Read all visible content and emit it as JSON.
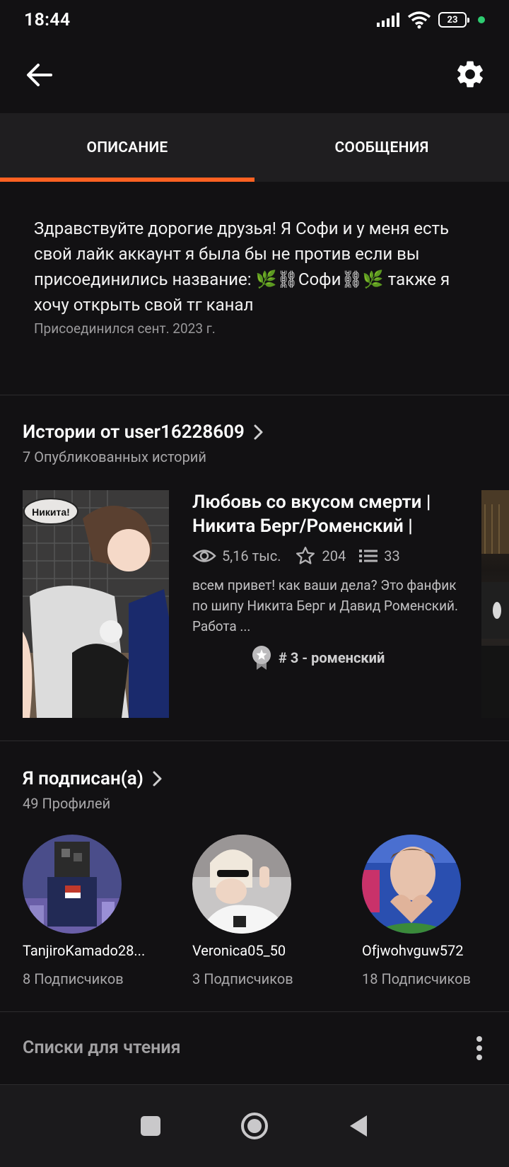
{
  "status_bar": {
    "time": "18:44",
    "battery": "23"
  },
  "tabs": [
    {
      "label": "ОПИСАНИЕ",
      "active": true
    },
    {
      "label": "СООБЩЕНИЯ",
      "active": false
    }
  ],
  "description": {
    "text": "Здравствуйте дорогие друзья! Я Софи и у меня есть свой лайк аккаунт я была бы не против если вы присоединились название: 🌿⛓Софи⛓🌿 также я хочу открыть свой тг канал",
    "joined": "Присоединился сент. 2023 г."
  },
  "stories": {
    "title": "Истории от user16228609",
    "subtitle": "7 Опубликованных историй",
    "story": {
      "title": "Любовь со вкусом смерти | Никита Берг/Роменский |",
      "cover_label": "Никита!",
      "views": "5,16 тыс.",
      "votes": "204",
      "parts": "33",
      "description": "всем привет! как ваши дела? Это фанфик по шипу Никита Берг и Давид Роменский. Работа ...",
      "rank": "# 3 - роменский"
    }
  },
  "following": {
    "title": "Я подписан(а)",
    "subtitle": "49 Профилей",
    "profiles": [
      {
        "name": "TanjiroKamado28...",
        "followers": "8 Подписчиков"
      },
      {
        "name": "Veronica05_50",
        "followers": "3 Подписчиков"
      },
      {
        "name": "Ofjwohvguw572",
        "followers": "18 Подписчиков"
      }
    ]
  },
  "reading_lists": {
    "label": "Списки для чтения"
  },
  "colors": {
    "accent": "#ff6122",
    "background": "#121113",
    "tab_bar": "#1f1e20"
  }
}
